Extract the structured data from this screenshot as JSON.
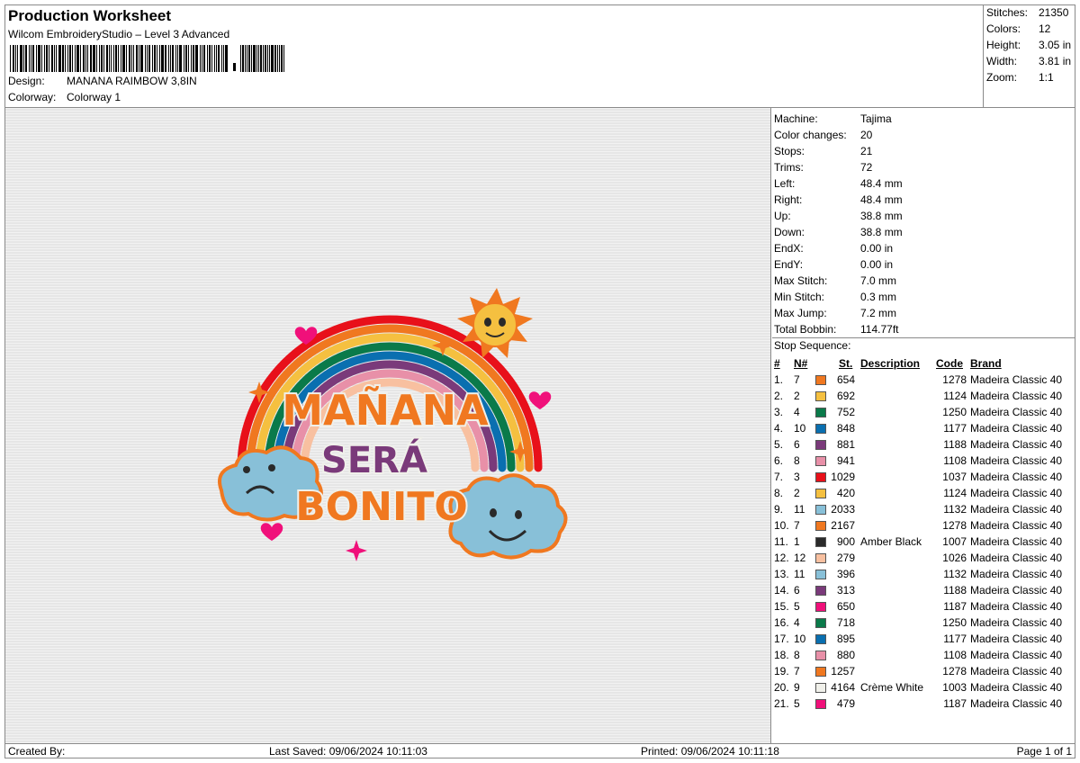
{
  "header": {
    "title": "Production Worksheet",
    "software": "Wilcom EmbroideryStudio – Level 3 Advanced",
    "design_label": "Design:",
    "design_value": "MANANA RAIMBOW 3,8IN",
    "colorway_label": "Colorway:",
    "colorway_value": "Colorway 1"
  },
  "summary": [
    {
      "label": "Stitches:",
      "value": "21350"
    },
    {
      "label": "Colors:",
      "value": "12"
    },
    {
      "label": "Height:",
      "value": "3.05 in"
    },
    {
      "label": "Width:",
      "value": "3.81 in"
    },
    {
      "label": "Zoom:",
      "value": "1:1"
    }
  ],
  "machine_info": [
    {
      "label": "Machine:",
      "value": "Tajima"
    },
    {
      "label": "Color changes:",
      "value": "20"
    },
    {
      "label": "Stops:",
      "value": "21"
    },
    {
      "label": "Trims:",
      "value": "72"
    },
    {
      "label": "Left:",
      "value": "48.4 mm"
    },
    {
      "label": "Right:",
      "value": "48.4 mm"
    },
    {
      "label": "Up:",
      "value": "38.8 mm"
    },
    {
      "label": "Down:",
      "value": "38.8 mm"
    },
    {
      "label": "EndX:",
      "value": "0.00 in"
    },
    {
      "label": "EndY:",
      "value": "0.00 in"
    },
    {
      "label": "Max Stitch:",
      "value": "7.0 mm"
    },
    {
      "label": "Min Stitch:",
      "value": "0.3 mm"
    },
    {
      "label": "Max Jump:",
      "value": "7.2 mm"
    },
    {
      "label": "Total Bobbin:",
      "value": "114.77ft"
    }
  ],
  "stop_sequence": {
    "title": "Stop Sequence:",
    "headers": {
      "idx": "#",
      "n": "N#",
      "st": "St.",
      "desc": "Description",
      "code": "Code",
      "brand": "Brand"
    },
    "rows": [
      {
        "idx": "1.",
        "n": "7",
        "color": "#f07820",
        "st": "654",
        "desc": "",
        "code": "1278",
        "brand": "Madeira Classic 40"
      },
      {
        "idx": "2.",
        "n": "2",
        "color": "#f5c040",
        "st": "692",
        "desc": "",
        "code": "1124",
        "brand": "Madeira Classic 40"
      },
      {
        "idx": "3.",
        "n": "4",
        "color": "#0a7a4a",
        "st": "752",
        "desc": "",
        "code": "1250",
        "brand": "Madeira Classic 40"
      },
      {
        "idx": "4.",
        "n": "10",
        "color": "#0a6fb0",
        "st": "848",
        "desc": "",
        "code": "1177",
        "brand": "Madeira Classic 40"
      },
      {
        "idx": "5.",
        "n": "6",
        "color": "#7a3a7a",
        "st": "881",
        "desc": "",
        "code": "1188",
        "brand": "Madeira Classic 40"
      },
      {
        "idx": "6.",
        "n": "8",
        "color": "#e890a8",
        "st": "941",
        "desc": "",
        "code": "1108",
        "brand": "Madeira Classic 40"
      },
      {
        "idx": "7.",
        "n": "3",
        "color": "#e8101a",
        "st": "1029",
        "desc": "",
        "code": "1037",
        "brand": "Madeira Classic 40"
      },
      {
        "idx": "8.",
        "n": "2",
        "color": "#f5c040",
        "st": "420",
        "desc": "",
        "code": "1124",
        "brand": "Madeira Classic 40"
      },
      {
        "idx": "9.",
        "n": "11",
        "color": "#88c0d8",
        "st": "2033",
        "desc": "",
        "code": "1132",
        "brand": "Madeira Classic 40"
      },
      {
        "idx": "10.",
        "n": "7",
        "color": "#f07820",
        "st": "2167",
        "desc": "",
        "code": "1278",
        "brand": "Madeira Classic 40"
      },
      {
        "idx": "11.",
        "n": "1",
        "color": "#2a2a2a",
        "st": "900",
        "desc": "Amber Black",
        "code": "1007",
        "brand": "Madeira Classic 40"
      },
      {
        "idx": "12.",
        "n": "12",
        "color": "#f8c0a0",
        "st": "279",
        "desc": "",
        "code": "1026",
        "brand": "Madeira Classic 40"
      },
      {
        "idx": "13.",
        "n": "11",
        "color": "#88c0d8",
        "st": "396",
        "desc": "",
        "code": "1132",
        "brand": "Madeira Classic 40"
      },
      {
        "idx": "14.",
        "n": "6",
        "color": "#7a3a7a",
        "st": "313",
        "desc": "",
        "code": "1188",
        "brand": "Madeira Classic 40"
      },
      {
        "idx": "15.",
        "n": "5",
        "color": "#f0107a",
        "st": "650",
        "desc": "",
        "code": "1187",
        "brand": "Madeira Classic 40"
      },
      {
        "idx": "16.",
        "n": "4",
        "color": "#0a7a4a",
        "st": "718",
        "desc": "",
        "code": "1250",
        "brand": "Madeira Classic 40"
      },
      {
        "idx": "17.",
        "n": "10",
        "color": "#0a6fb0",
        "st": "895",
        "desc": "",
        "code": "1177",
        "brand": "Madeira Classic 40"
      },
      {
        "idx": "18.",
        "n": "8",
        "color": "#e890a8",
        "st": "880",
        "desc": "",
        "code": "1108",
        "brand": "Madeira Classic 40"
      },
      {
        "idx": "19.",
        "n": "7",
        "color": "#f07820",
        "st": "1257",
        "desc": "",
        "code": "1278",
        "brand": "Madeira Classic 40"
      },
      {
        "idx": "20.",
        "n": "9",
        "color": "#f0f0ea",
        "st": "4164",
        "desc": "Crème White",
        "code": "1003",
        "brand": "Madeira Classic 40"
      },
      {
        "idx": "21.",
        "n": "5",
        "color": "#f0107a",
        "st": "479",
        "desc": "",
        "code": "1187",
        "brand": "Madeira Classic 40"
      }
    ]
  },
  "design_preview": {
    "text_lines": [
      "MAÑANA",
      "SERÁ",
      "BONITO"
    ],
    "colors": {
      "rainbow": [
        "#e8101a",
        "#f07820",
        "#f5c040",
        "#0a7a4a",
        "#0a6fb0",
        "#7a3a7a",
        "#e890a8",
        "#f8c0a0"
      ],
      "cloud": "#88c0d8",
      "cloud_outline": "#f07820",
      "sun": "#f5c040",
      "heart": "#f0107a"
    }
  },
  "footer": {
    "created_by": "Created By:",
    "last_saved": "Last Saved: 09/06/2024 10:11:03",
    "printed": "Printed: 09/06/2024 10:11:18",
    "page": "Page 1 of 1"
  }
}
